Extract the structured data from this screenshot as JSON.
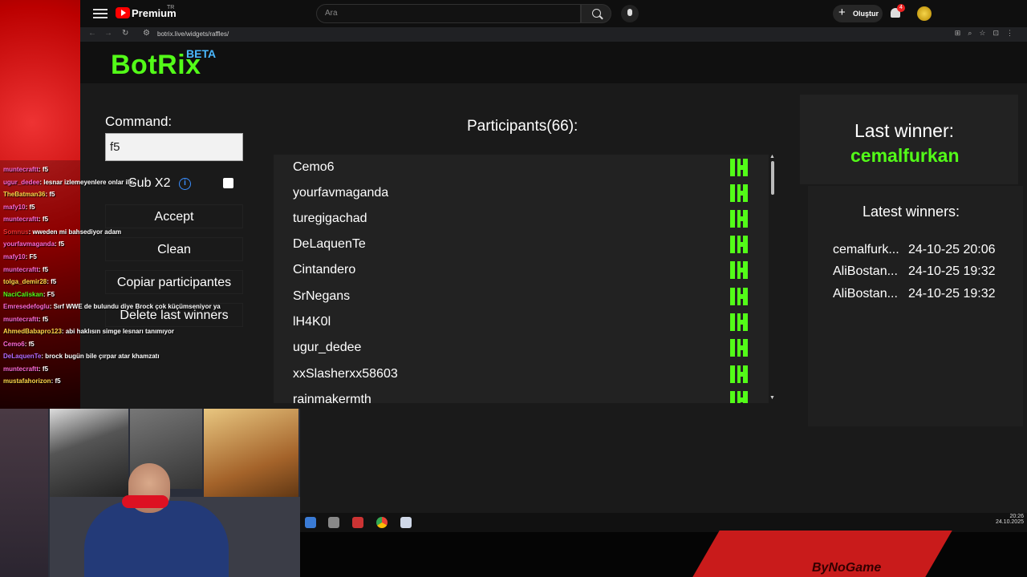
{
  "youtube": {
    "brand": "Premium",
    "brand_sup": "TR",
    "search_placeholder": "Ara",
    "create_label": "Oluştur",
    "notifications_count": "4"
  },
  "browser": {
    "url": "botrix.live/widgets/raffles/"
  },
  "botrix": {
    "logo": "BotRix",
    "logo_badge": "BETA",
    "command_label": "Command:",
    "command_value": "f5",
    "subx2_label": "Sub X2",
    "buttons": {
      "accept": "Accept",
      "clean": "Clean",
      "copy": "Copiar participantes",
      "delete": "Delete last winners"
    },
    "participants_title": "Participants(66):",
    "participants": [
      "Cemo6",
      "yourfavmaganda",
      "turegigachad",
      "DeLaquenTe",
      "Cintandero",
      "SrNegans",
      "lH4K0l",
      "ugur_dedee",
      "xxSlasherxx58603",
      "rainmakermth"
    ],
    "last_winner_label": "Last winner:",
    "last_winner_name": "cemalfurkan",
    "latest_winners_title": "Latest winners:",
    "latest_winners": [
      {
        "name": "cemalfurk...",
        "date": "24-10-25 20:06"
      },
      {
        "name": "AliBostan...",
        "date": "24-10-25 19:32"
      },
      {
        "name": "AliBostan...",
        "date": "24-10-25 19:32"
      }
    ]
  },
  "chat": [
    {
      "user": "muntecraftt",
      "msg": ": f5",
      "color": "#ff6ad5"
    },
    {
      "user": "ugur_dedee",
      "msg": ": lesnar izlemeyenlere onlar ilk..",
      "color": "#ff6ad5"
    },
    {
      "user": "TheBatman36",
      "msg": ": f5",
      "color": "#ffd84a"
    },
    {
      "user": "mafy10",
      "msg": ": f5",
      "color": "#ff6ad5"
    },
    {
      "user": "muntecraftt",
      "msg": ": f5",
      "color": "#ff6ad5"
    },
    {
      "user": "Somnus",
      "msg": ": wweden mi bahsediyor adam",
      "color": "#e33"
    },
    {
      "user": "yourfavmaganda",
      "msg": ": f5",
      "color": "#ff6ad5"
    },
    {
      "user": "mafy10",
      "msg": ": F5",
      "color": "#ff6ad5"
    },
    {
      "user": "muntecraftt",
      "msg": ": f5",
      "color": "#ff6ad5"
    },
    {
      "user": "tolga_demir28",
      "msg": ": f5",
      "color": "#ffd84a"
    },
    {
      "user": "NaciCaliskan",
      "msg": ": F5",
      "color": "#53fc18"
    },
    {
      "user": "Emresedefoglu",
      "msg": ": Sırf WWE de bulundu diye Brock çok küçümseniyor ya",
      "color": "#ff6ad5"
    },
    {
      "user": "muntecraftt",
      "msg": ": f5",
      "color": "#ff6ad5"
    },
    {
      "user": "AhmedBabapro123",
      "msg": ": abi haklısın simge lesnarı tanımıyor",
      "color": "#ffd84a"
    },
    {
      "user": "Cemo6",
      "msg": ": f5",
      "color": "#ff6ad5"
    },
    {
      "user": "DeLaquenTe",
      "msg": ": brock bugün bile çırpar atar khamzatı",
      "color": "#b36bff"
    },
    {
      "user": "muntecraftt",
      "msg": ": f5",
      "color": "#ff6ad5"
    },
    {
      "user": "mustafahorizon",
      "msg": ": f5",
      "color": "#ffd84a"
    }
  ],
  "taskbar": {
    "time": "20:26",
    "date": "24.10.2025"
  },
  "brand_strip": "ByNoGame",
  "colors": {
    "kick_green": "#53fc18",
    "beta_blue": "#4ab8ff",
    "yt_red": "#ff0000"
  }
}
